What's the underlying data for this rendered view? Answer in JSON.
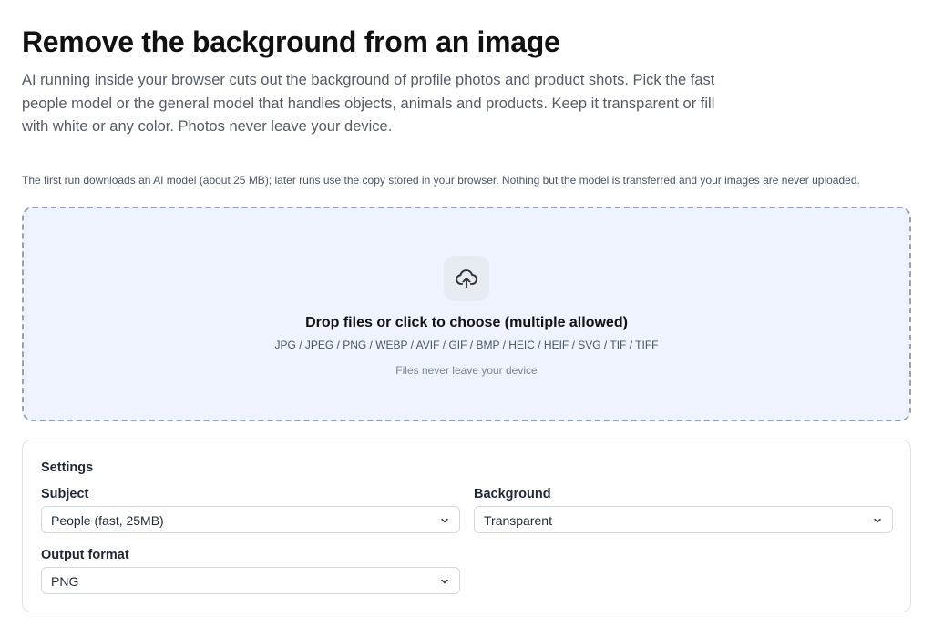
{
  "header": {
    "title": "Remove the background from an image",
    "intro": "AI running inside your browser cuts out the background of profile photos and product shots. Pick the fast people model or the general model that handles objects, animals and products. Keep it transparent or fill with white or any color. Photos never leave your device."
  },
  "notice": "The first run downloads an AI model (about 25 MB); later runs use the copy stored in your browser. Nothing but the model is transferred and your images are never uploaded.",
  "dropzone": {
    "icon": "cloud-upload-icon",
    "title": "Drop files or click to choose (multiple allowed)",
    "formats": "JPG / JPEG / PNG / WEBP / AVIF / GIF / BMP / HEIC / HEIF / SVG / TIF / TIFF",
    "privacy": "Files never leave your device"
  },
  "settings": {
    "heading": "Settings",
    "subject": {
      "label": "Subject",
      "value": "People (fast, 25MB)"
    },
    "background": {
      "label": "Background",
      "value": "Transparent"
    },
    "output_format": {
      "label": "Output format",
      "value": "PNG"
    }
  },
  "colors": {
    "dropzone_bg": "#eef3fd",
    "dropzone_border": "#94a3b8",
    "text_primary": "#111111",
    "text_muted": "#555c66"
  }
}
